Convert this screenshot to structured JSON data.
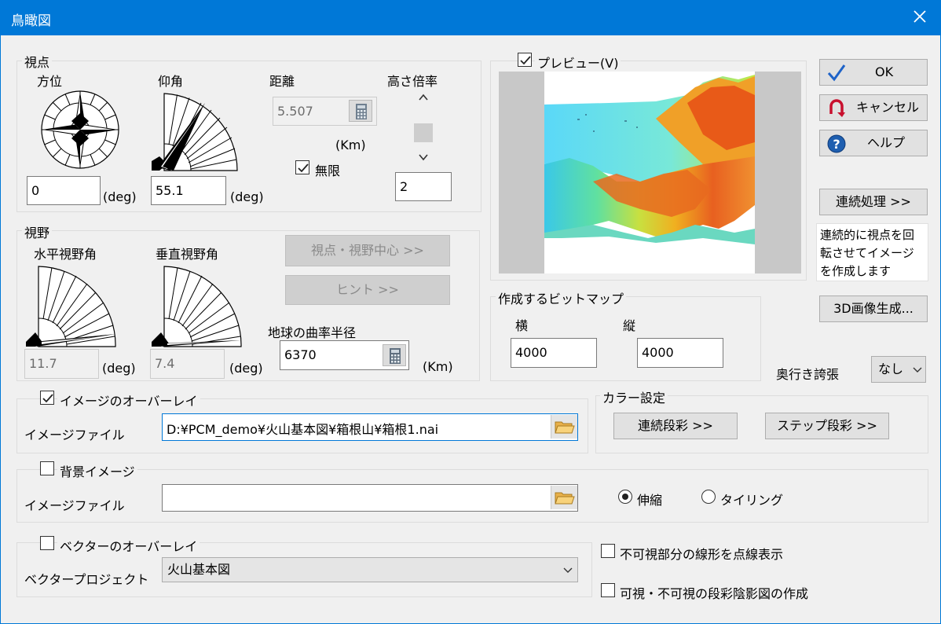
{
  "window": {
    "title": "鳥瞰図"
  },
  "viewpoint": {
    "legend": "視点",
    "azimuth": {
      "label": "方位",
      "value": "0",
      "unit": "(deg)"
    },
    "elevation": {
      "label": "仰角",
      "value": "55.1",
      "unit": "(deg)"
    },
    "distance": {
      "label": "距離",
      "value": "5.507",
      "unit": "(Km)",
      "infinite_label": "無限",
      "infinite_checked": true
    },
    "height_ratio": {
      "label": "高さ倍率",
      "value": "2"
    }
  },
  "fov": {
    "legend": "視野",
    "horizontal": {
      "label": "水平視野角",
      "value": "11.7",
      "unit": "(deg)"
    },
    "vertical": {
      "label": "垂直視野角",
      "value": "7.4",
      "unit": "(deg)"
    },
    "center_button": "視点・視野中心 >>",
    "hint_button": "ヒント >>",
    "earth_radius": {
      "label": "地球の曲率半径",
      "value": "6370",
      "unit": "(Km)"
    }
  },
  "preview": {
    "label": "プレビュー(V)",
    "checked": true
  },
  "buttons": {
    "ok": "OK",
    "cancel": "キャンセル",
    "help": "ヘルプ",
    "continuous": "連続処理 >>",
    "generate_3d": "3D画像生成..."
  },
  "continuous_desc": "連続的に視点を回転させてイメージを作成します",
  "bitmap": {
    "legend": "作成するビットマップ",
    "width_label": "横",
    "width_value": "4000",
    "height_label": "縦",
    "height_value": "4000"
  },
  "depth": {
    "label": "奥行き誇張",
    "value": "なし"
  },
  "image_overlay": {
    "legend": "イメージのオーバーレイ",
    "checked": true,
    "file_label": "イメージファイル",
    "file_value": "D:¥PCM_demo¥火山基本図¥箱根山¥箱根1.nai"
  },
  "color": {
    "legend": "カラー設定",
    "continuous": "連続段彩 >>",
    "step": "ステップ段彩 >>"
  },
  "background": {
    "legend": "背景イメージ",
    "checked": false,
    "file_label": "イメージファイル",
    "file_value": "",
    "stretch": "伸縮",
    "tiling": "タイリング",
    "selected": "stretch"
  },
  "vector": {
    "legend": "ベクターのオーバーレイ",
    "checked": false,
    "project_label": "ベクタープロジェクト",
    "project_value": "火山基本図"
  },
  "options": {
    "dotted_hidden": "不可視部分の線形を点線表示",
    "visibility_map": "可視・不可視の段彩陰影図の作成"
  },
  "colors": {
    "title_bar": "#0078d7",
    "accent_check": "#1e63c8",
    "cancel_red": "#c8102e"
  }
}
